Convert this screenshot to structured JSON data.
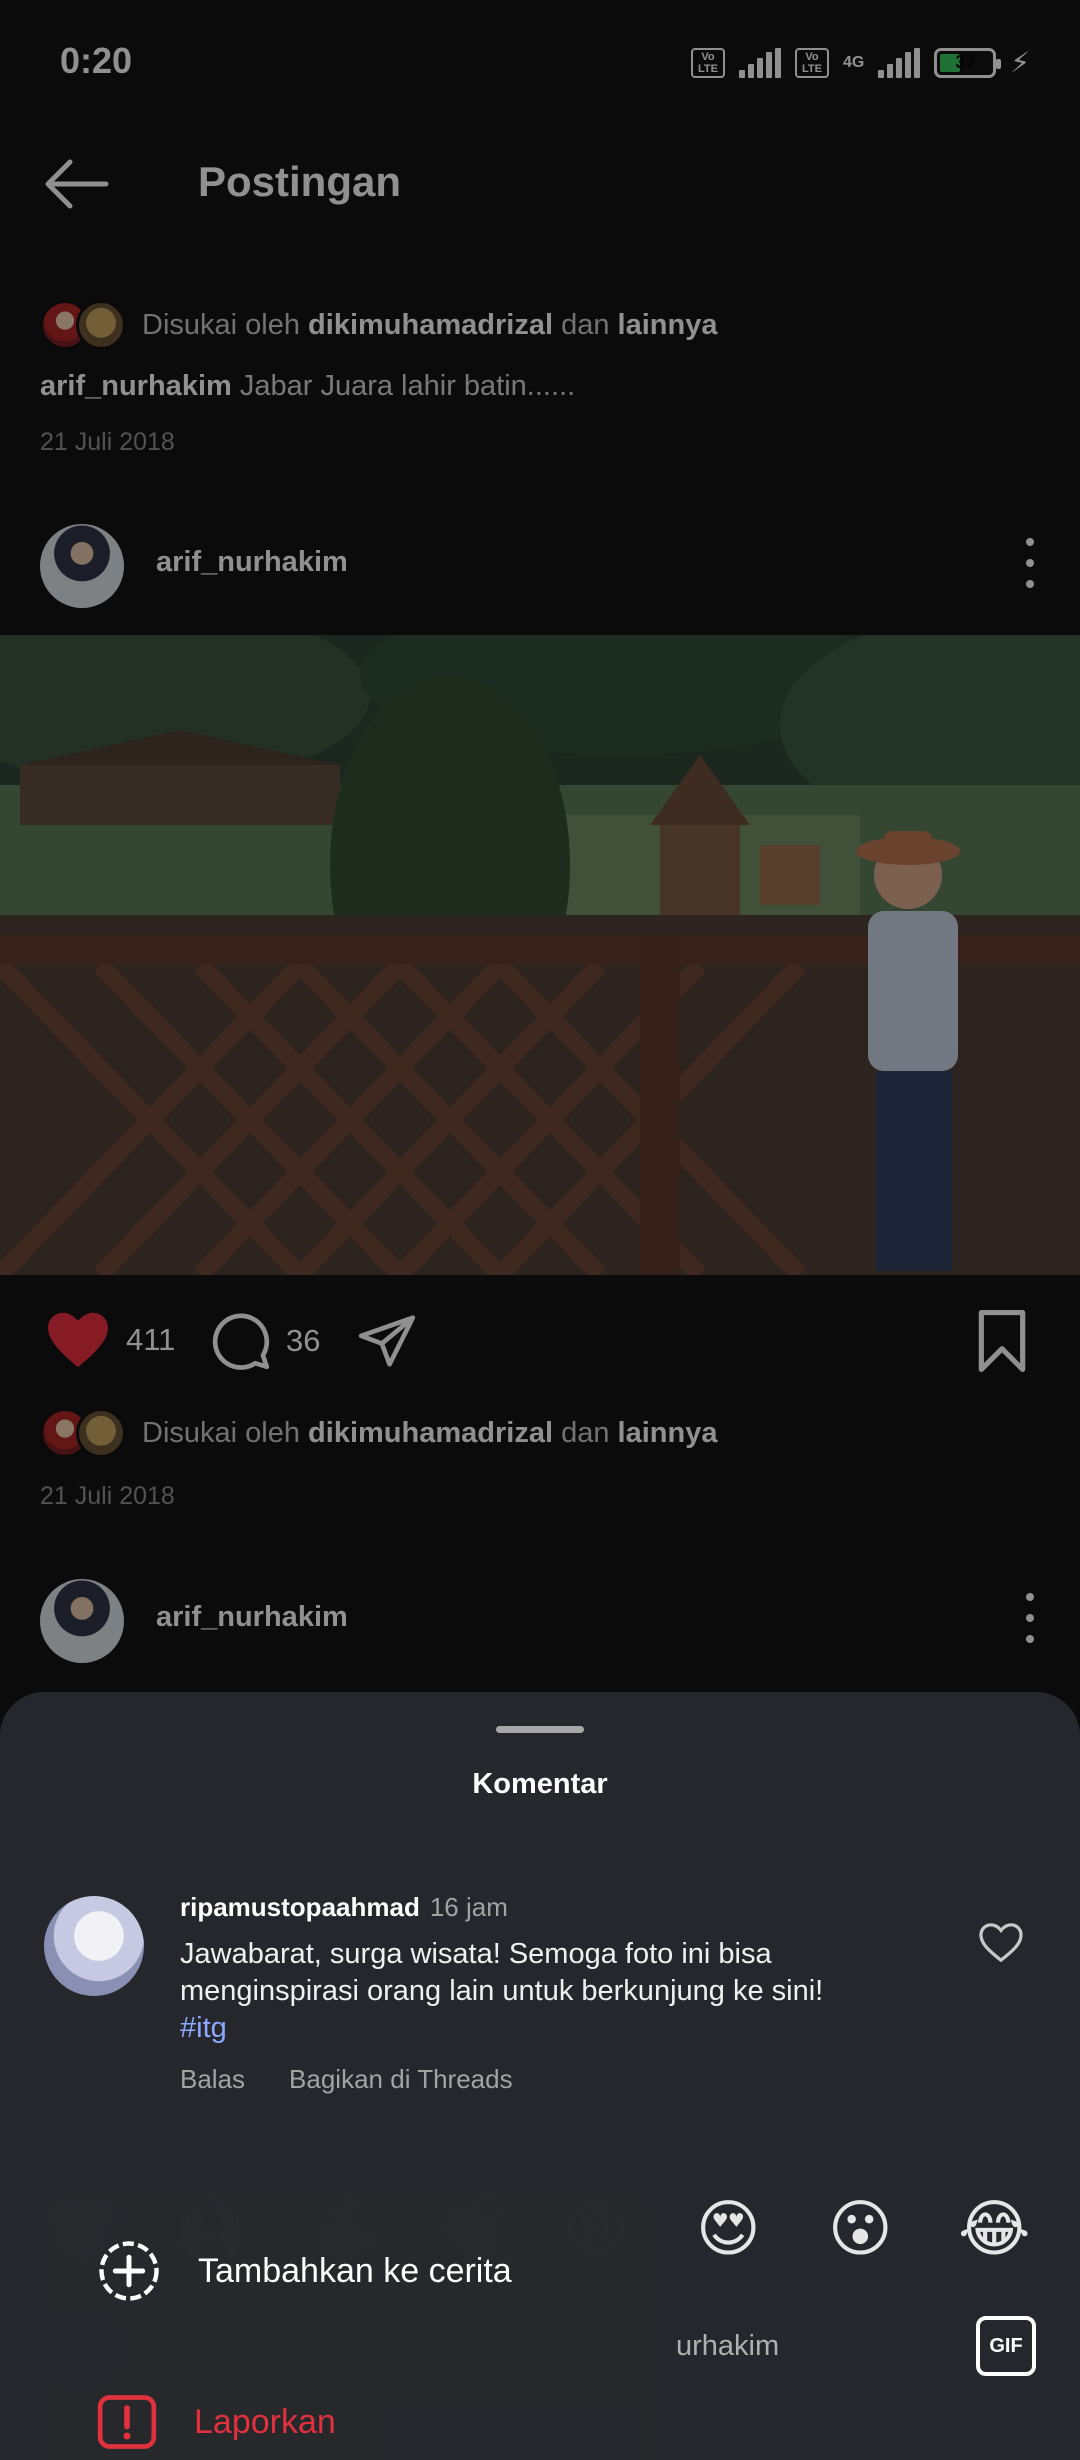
{
  "status_bar": {
    "time": "0:20",
    "volte": "Vo LTE",
    "network": "4G",
    "battery": "37"
  },
  "header": {
    "title": "Postingan"
  },
  "post_prev": {
    "liked_prefix": "Disukai oleh",
    "liked_user": "dikimuhamadrizal",
    "liked_and": "dan",
    "liked_others": "lainnya",
    "caption_user": "arif_nurhakim",
    "caption_text": "Jabar Juara lahir batin......",
    "date": "21 Juli 2018"
  },
  "post": {
    "username": "arif_nurhakim",
    "likes": "411",
    "comments": "36",
    "liked_prefix": "Disukai oleh",
    "liked_user": "dikimuhamadrizal",
    "liked_and": "dan",
    "liked_others": "lainnya",
    "date": "21 Juli 2018"
  },
  "post_next": {
    "username": "arif_nurhakim"
  },
  "comments_sheet": {
    "title": "Komentar",
    "comment": {
      "username": "ripamustopaahmad",
      "time": "16 jam",
      "text": "Jawabarat, surga wisata!  Semoga foto ini bisa menginspirasi orang lain untuk berkunjung ke sini!",
      "hashtag": "#itg",
      "reply": "Balas",
      "share": "Bagikan di Threads"
    },
    "emojis": [
      "❤️",
      "🙌",
      "🔥",
      "👏",
      "😢",
      "😍",
      "😮",
      "😂"
    ],
    "input_placeholder_suffix": "urhakim",
    "gif_label": "GIF"
  },
  "popup_menu": {
    "add_story": "Tambahkan ke cerita",
    "report": "Laporkan"
  },
  "colors": {
    "like_red": "#ee2b3b",
    "report_red": "#e0313d",
    "hashtag_blue": "#8ca8ff",
    "sheet_bg": "#25272c"
  }
}
